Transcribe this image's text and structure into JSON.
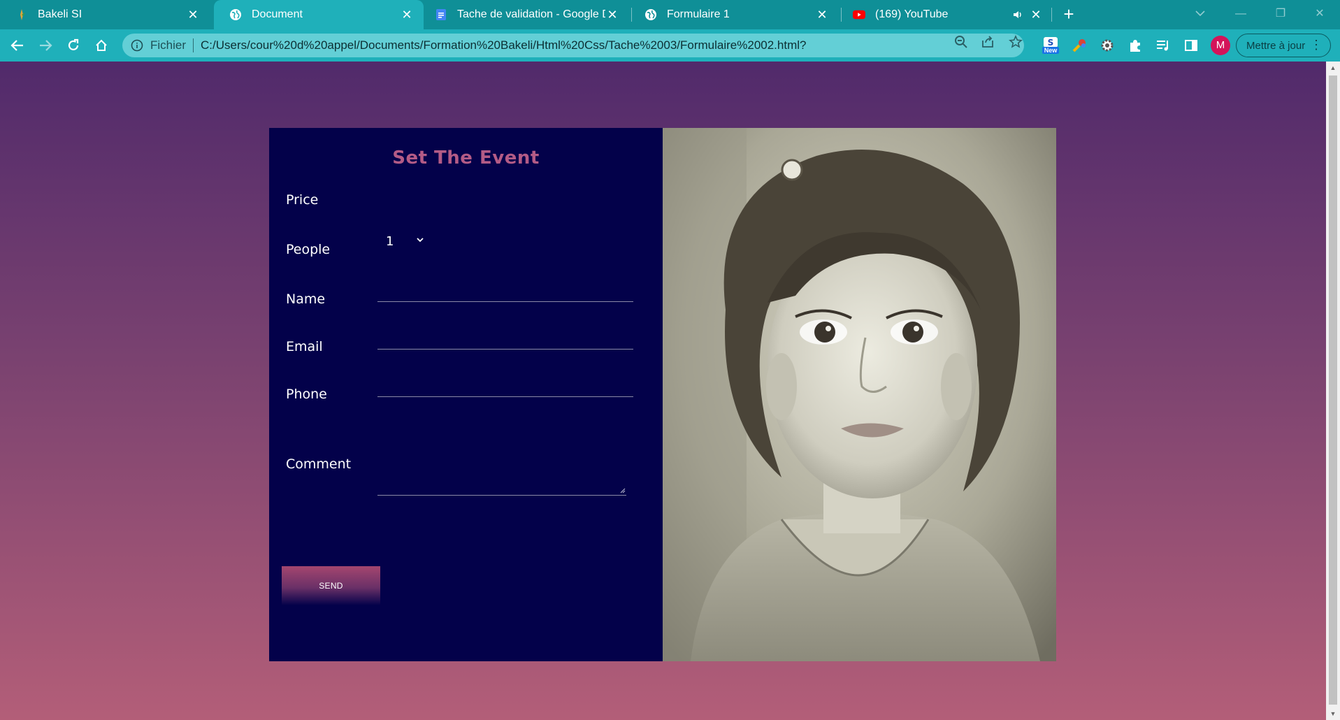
{
  "browser": {
    "tabs": [
      {
        "title": "Bakeli SI",
        "favicon": "bakeli-icon",
        "active": false
      },
      {
        "title": "Document",
        "favicon": "globe-icon",
        "active": true
      },
      {
        "title": "Tache de validation - Google Doc",
        "favicon": "google-docs-icon",
        "active": false
      },
      {
        "title": "Formulaire 1",
        "favicon": "globe-icon",
        "active": false
      },
      {
        "title": "(169) YouTube",
        "favicon": "youtube-icon",
        "active": false,
        "audio": true
      }
    ],
    "omnibox": {
      "scheme_label": "Fichier",
      "url": "C:/Users/cour%20d%20appel/Documents/Formation%20Bakeli/Html%20Css/Tache%2003/Formulaire%2002.html?"
    },
    "extensions": {
      "new_badge": "New"
    },
    "profile_initial": "M",
    "update_button": "Mettre à jour"
  },
  "colors": {
    "tabbar": "#0f8f97",
    "toolbar": "#1fb0ba",
    "form_bg": "#03014a",
    "title_color": "#b35b86",
    "bg_top": "#512a6b",
    "bg_bottom": "#b35e78"
  },
  "form": {
    "title": "Set The Event",
    "labels": {
      "price": "Price",
      "people": "People",
      "name": "Name",
      "email": "Email",
      "phone": "Phone",
      "comment": "Comment"
    },
    "people_value": "1",
    "send_label": "SEND"
  }
}
